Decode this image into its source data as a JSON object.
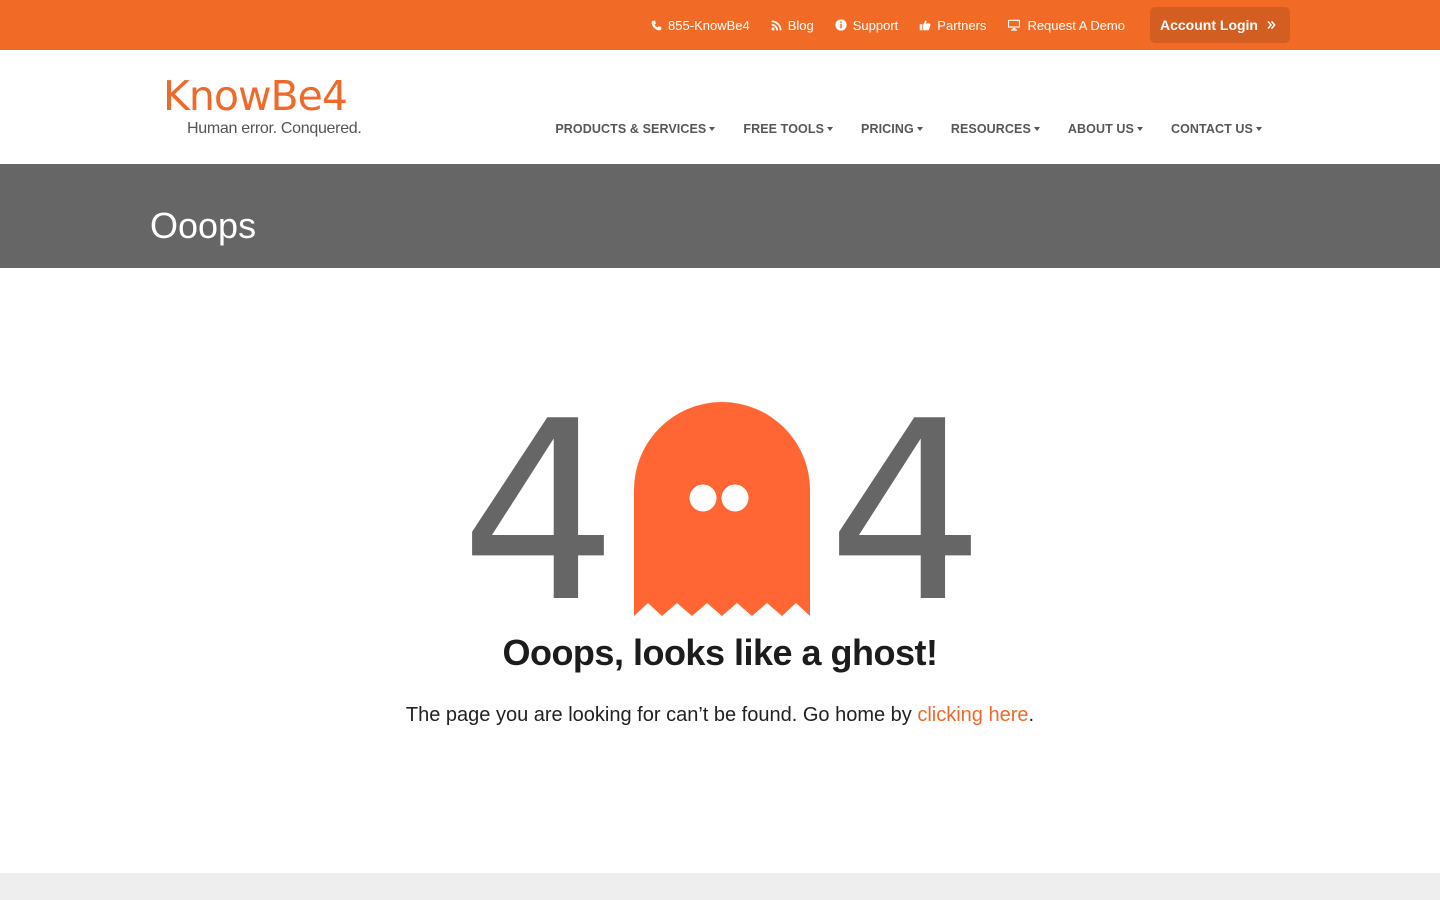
{
  "colors": {
    "brand": "#f26b26",
    "title_band": "#666666",
    "ghost": "#ff6633",
    "link": "#ef6a2a"
  },
  "topbar": {
    "links": [
      {
        "label": "855-KnowBe4",
        "icon": "phone-icon"
      },
      {
        "label": "Blog",
        "icon": "rss-icon"
      },
      {
        "label": "Support",
        "icon": "info-icon"
      },
      {
        "label": "Partners",
        "icon": "thumbs-up-icon"
      },
      {
        "label": "Request A Demo",
        "icon": "desktop-icon"
      }
    ],
    "login_label": "Account Login",
    "login_icon": "double-chevron-right-icon"
  },
  "logo": {
    "wordmark": "KnowBe4",
    "tagline": "Human error. Conquered."
  },
  "nav": {
    "items": [
      {
        "label": "PRODUCTS & SERVICES"
      },
      {
        "label": "FREE TOOLS"
      },
      {
        "label": "PRICING"
      },
      {
        "label": "RESOURCES"
      },
      {
        "label": "ABOUT US"
      },
      {
        "label": "CONTACT US"
      }
    ]
  },
  "page": {
    "title": "Ooops"
  },
  "error": {
    "digit_left": "4",
    "digit_right": "4",
    "headline": "Ooops, looks like a ghost!",
    "message": "The page you are looking for can’t be found. Go home by ",
    "link_label": "clicking here",
    "message_end": "."
  }
}
